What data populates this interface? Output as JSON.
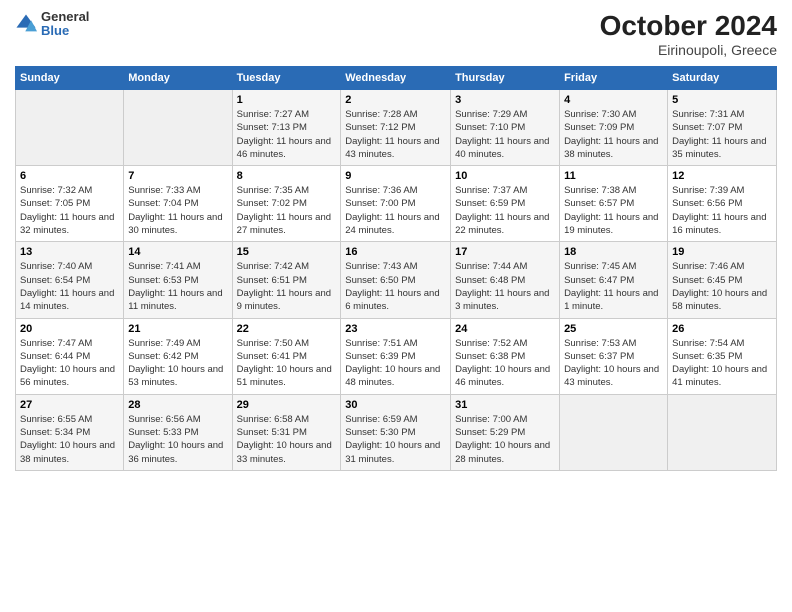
{
  "logo": {
    "line1": "General",
    "line2": "Blue"
  },
  "header": {
    "title": "October 2024",
    "subtitle": "Eirinoupoli, Greece"
  },
  "days": [
    "Sunday",
    "Monday",
    "Tuesday",
    "Wednesday",
    "Thursday",
    "Friday",
    "Saturday"
  ],
  "weeks": [
    [
      {
        "num": "",
        "sunrise": "",
        "sunset": "",
        "daylight": ""
      },
      {
        "num": "",
        "sunrise": "",
        "sunset": "",
        "daylight": ""
      },
      {
        "num": "1",
        "sunrise": "Sunrise: 7:27 AM",
        "sunset": "Sunset: 7:13 PM",
        "daylight": "Daylight: 11 hours and 46 minutes."
      },
      {
        "num": "2",
        "sunrise": "Sunrise: 7:28 AM",
        "sunset": "Sunset: 7:12 PM",
        "daylight": "Daylight: 11 hours and 43 minutes."
      },
      {
        "num": "3",
        "sunrise": "Sunrise: 7:29 AM",
        "sunset": "Sunset: 7:10 PM",
        "daylight": "Daylight: 11 hours and 40 minutes."
      },
      {
        "num": "4",
        "sunrise": "Sunrise: 7:30 AM",
        "sunset": "Sunset: 7:09 PM",
        "daylight": "Daylight: 11 hours and 38 minutes."
      },
      {
        "num": "5",
        "sunrise": "Sunrise: 7:31 AM",
        "sunset": "Sunset: 7:07 PM",
        "daylight": "Daylight: 11 hours and 35 minutes."
      }
    ],
    [
      {
        "num": "6",
        "sunrise": "Sunrise: 7:32 AM",
        "sunset": "Sunset: 7:05 PM",
        "daylight": "Daylight: 11 hours and 32 minutes."
      },
      {
        "num": "7",
        "sunrise": "Sunrise: 7:33 AM",
        "sunset": "Sunset: 7:04 PM",
        "daylight": "Daylight: 11 hours and 30 minutes."
      },
      {
        "num": "8",
        "sunrise": "Sunrise: 7:35 AM",
        "sunset": "Sunset: 7:02 PM",
        "daylight": "Daylight: 11 hours and 27 minutes."
      },
      {
        "num": "9",
        "sunrise": "Sunrise: 7:36 AM",
        "sunset": "Sunset: 7:00 PM",
        "daylight": "Daylight: 11 hours and 24 minutes."
      },
      {
        "num": "10",
        "sunrise": "Sunrise: 7:37 AM",
        "sunset": "Sunset: 6:59 PM",
        "daylight": "Daylight: 11 hours and 22 minutes."
      },
      {
        "num": "11",
        "sunrise": "Sunrise: 7:38 AM",
        "sunset": "Sunset: 6:57 PM",
        "daylight": "Daylight: 11 hours and 19 minutes."
      },
      {
        "num": "12",
        "sunrise": "Sunrise: 7:39 AM",
        "sunset": "Sunset: 6:56 PM",
        "daylight": "Daylight: 11 hours and 16 minutes."
      }
    ],
    [
      {
        "num": "13",
        "sunrise": "Sunrise: 7:40 AM",
        "sunset": "Sunset: 6:54 PM",
        "daylight": "Daylight: 11 hours and 14 minutes."
      },
      {
        "num": "14",
        "sunrise": "Sunrise: 7:41 AM",
        "sunset": "Sunset: 6:53 PM",
        "daylight": "Daylight: 11 hours and 11 minutes."
      },
      {
        "num": "15",
        "sunrise": "Sunrise: 7:42 AM",
        "sunset": "Sunset: 6:51 PM",
        "daylight": "Daylight: 11 hours and 9 minutes."
      },
      {
        "num": "16",
        "sunrise": "Sunrise: 7:43 AM",
        "sunset": "Sunset: 6:50 PM",
        "daylight": "Daylight: 11 hours and 6 minutes."
      },
      {
        "num": "17",
        "sunrise": "Sunrise: 7:44 AM",
        "sunset": "Sunset: 6:48 PM",
        "daylight": "Daylight: 11 hours and 3 minutes."
      },
      {
        "num": "18",
        "sunrise": "Sunrise: 7:45 AM",
        "sunset": "Sunset: 6:47 PM",
        "daylight": "Daylight: 11 hours and 1 minute."
      },
      {
        "num": "19",
        "sunrise": "Sunrise: 7:46 AM",
        "sunset": "Sunset: 6:45 PM",
        "daylight": "Daylight: 10 hours and 58 minutes."
      }
    ],
    [
      {
        "num": "20",
        "sunrise": "Sunrise: 7:47 AM",
        "sunset": "Sunset: 6:44 PM",
        "daylight": "Daylight: 10 hours and 56 minutes."
      },
      {
        "num": "21",
        "sunrise": "Sunrise: 7:49 AM",
        "sunset": "Sunset: 6:42 PM",
        "daylight": "Daylight: 10 hours and 53 minutes."
      },
      {
        "num": "22",
        "sunrise": "Sunrise: 7:50 AM",
        "sunset": "Sunset: 6:41 PM",
        "daylight": "Daylight: 10 hours and 51 minutes."
      },
      {
        "num": "23",
        "sunrise": "Sunrise: 7:51 AM",
        "sunset": "Sunset: 6:39 PM",
        "daylight": "Daylight: 10 hours and 48 minutes."
      },
      {
        "num": "24",
        "sunrise": "Sunrise: 7:52 AM",
        "sunset": "Sunset: 6:38 PM",
        "daylight": "Daylight: 10 hours and 46 minutes."
      },
      {
        "num": "25",
        "sunrise": "Sunrise: 7:53 AM",
        "sunset": "Sunset: 6:37 PM",
        "daylight": "Daylight: 10 hours and 43 minutes."
      },
      {
        "num": "26",
        "sunrise": "Sunrise: 7:54 AM",
        "sunset": "Sunset: 6:35 PM",
        "daylight": "Daylight: 10 hours and 41 minutes."
      }
    ],
    [
      {
        "num": "27",
        "sunrise": "Sunrise: 6:55 AM",
        "sunset": "Sunset: 5:34 PM",
        "daylight": "Daylight: 10 hours and 38 minutes."
      },
      {
        "num": "28",
        "sunrise": "Sunrise: 6:56 AM",
        "sunset": "Sunset: 5:33 PM",
        "daylight": "Daylight: 10 hours and 36 minutes."
      },
      {
        "num": "29",
        "sunrise": "Sunrise: 6:58 AM",
        "sunset": "Sunset: 5:31 PM",
        "daylight": "Daylight: 10 hours and 33 minutes."
      },
      {
        "num": "30",
        "sunrise": "Sunrise: 6:59 AM",
        "sunset": "Sunset: 5:30 PM",
        "daylight": "Daylight: 10 hours and 31 minutes."
      },
      {
        "num": "31",
        "sunrise": "Sunrise: 7:00 AM",
        "sunset": "Sunset: 5:29 PM",
        "daylight": "Daylight: 10 hours and 28 minutes."
      },
      {
        "num": "",
        "sunrise": "",
        "sunset": "",
        "daylight": ""
      },
      {
        "num": "",
        "sunrise": "",
        "sunset": "",
        "daylight": ""
      }
    ]
  ]
}
